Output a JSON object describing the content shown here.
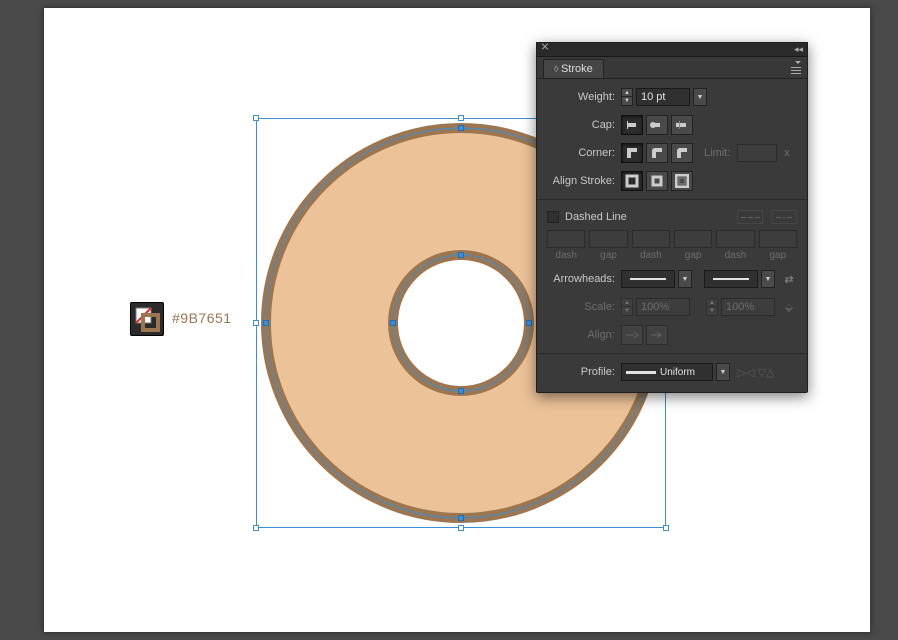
{
  "colors": {
    "stroke": "#9B7651",
    "fill": "#ECC298",
    "selection": "#3a8fd6",
    "panel_bg": "#3a3a3a"
  },
  "swatch_label": "#9B7651",
  "panel": {
    "title": "Stroke",
    "weight": {
      "label": "Weight:",
      "value": "10 pt"
    },
    "cap": {
      "label": "Cap:"
    },
    "corner": {
      "label": "Corner:",
      "limit_label": "Limit:",
      "limit_suffix": "x"
    },
    "align": {
      "label": "Align Stroke:"
    },
    "dashed": {
      "label": "Dashed Line",
      "segments_label": [
        "dash",
        "gap",
        "dash",
        "gap",
        "dash",
        "gap"
      ]
    },
    "arrowheads": {
      "label": "Arrowheads:"
    },
    "scale": {
      "label": "Scale:",
      "value_left": "100%",
      "value_right": "100%"
    },
    "align_arrow": {
      "label": "Align:"
    },
    "profile": {
      "label": "Profile:",
      "value": "Uniform"
    }
  }
}
